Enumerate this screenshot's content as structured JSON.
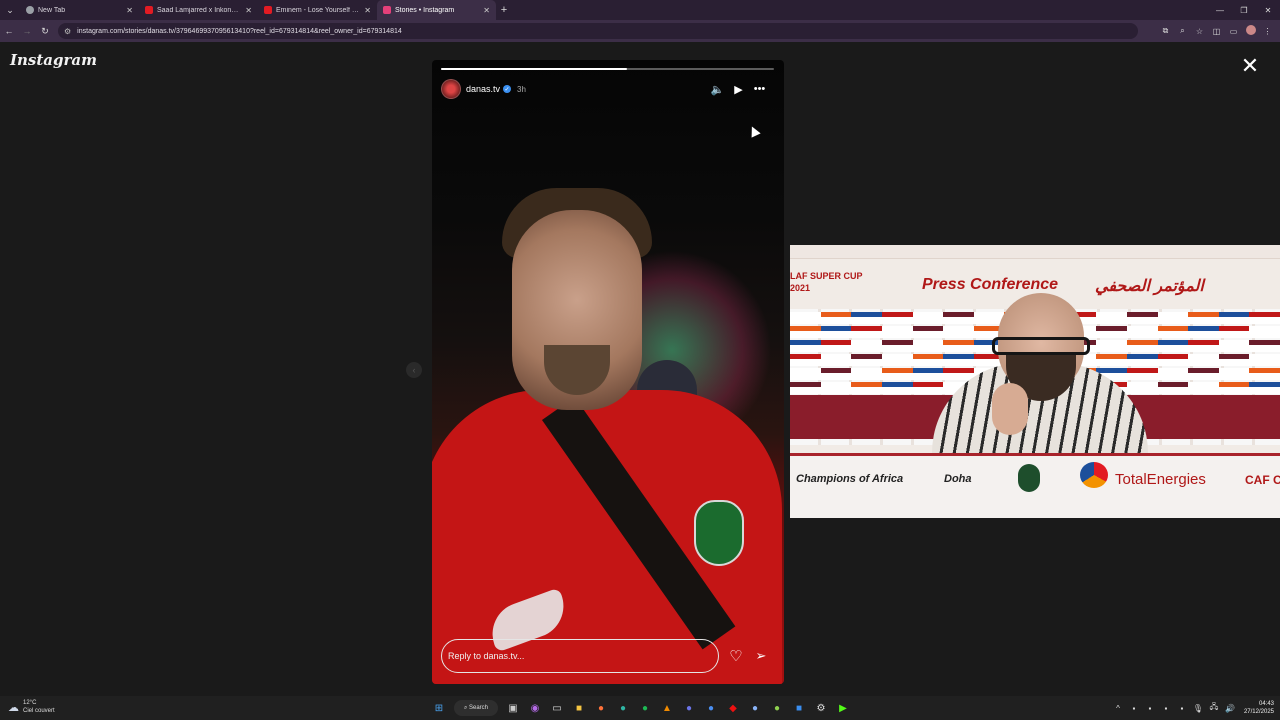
{
  "browser": {
    "tabs": [
      {
        "label": "New Tab",
        "favicon_color": "#9aa0a6",
        "active": false
      },
      {
        "label": "Saad Lamjarred x Inkonnu x Ati",
        "favicon_color": "#e21b23",
        "active": false
      },
      {
        "label": "Eminem - Lose Yourself - YouTu",
        "favicon_color": "#e21b23",
        "active": false
      },
      {
        "label": "Stories • Instagram",
        "favicon_color": "#e4407a",
        "active": true
      }
    ],
    "url": "instagram.com/stories/danas.tv/3796469937095613410?reel_id=679314814&reel_owner_id=679314814"
  },
  "page": {
    "logo": "Instagram",
    "close_icon": "close-icon"
  },
  "story": {
    "username": "danas.tv",
    "time": "3h",
    "progress": 0.56,
    "reply_placeholder": "Reply to danas.tv..."
  },
  "overlay_video": {
    "caf_line1": "LAF SUPER CUP",
    "caf_line2": "2021",
    "press_title": "Press Conference",
    "press_arabic": "المؤتمر الصحفي",
    "champions": "Champions of Africa",
    "doha": "Doha",
    "sponsor": "TotalEnergies",
    "caf_right": "CAF C"
  },
  "taskbar": {
    "temperature": "12°C",
    "weather": "Ciel couvert",
    "search_label": "Search",
    "time": "04:43",
    "date": "27/12/2025"
  },
  "colors": {
    "chrome_bg": "#2a1f33",
    "instagram_accent": "#e4407a",
    "caf_red": "#b01818"
  }
}
